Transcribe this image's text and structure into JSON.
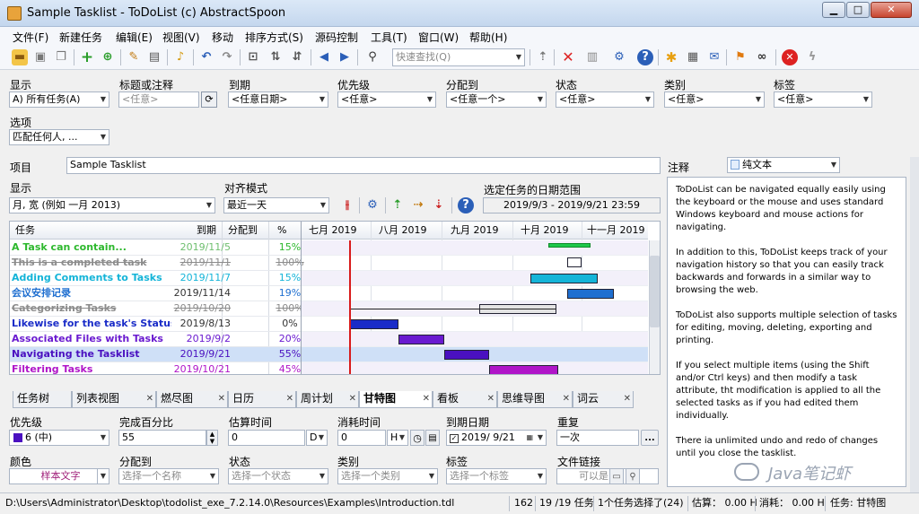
{
  "window": {
    "title": "Sample Tasklist - ToDoList (c) AbstractSpoon",
    "min": "▁",
    "max": "□",
    "close": "✕"
  },
  "menu": [
    "文件(F)",
    "新建任务",
    "编辑(E)",
    "视图(V)",
    "移动",
    "排序方式(S)",
    "源码控制",
    "工具(T)",
    "窗口(W)",
    "帮助(H)"
  ],
  "toolbar": {
    "quickfind_placeholder": "快速查找(Q)"
  },
  "filters": {
    "show_label": "显示",
    "show_value": "A)  所有任务(A)",
    "title_label": "标题或注释",
    "title_value": "<任意>",
    "due_label": "到期",
    "due_value": "<任意日期>",
    "priority_label": "优先级",
    "priority_value": "<任意>",
    "alloc_label": "分配到",
    "alloc_value": "<任意一个>",
    "status_label": "状态",
    "status_value": "<任意>",
    "category_label": "类别",
    "category_value": "<任意>",
    "tags_label": "标签",
    "tags_value": "<任意>",
    "options_label": "选项",
    "options_value": "匹配任何人, ..."
  },
  "project": {
    "label": "项目",
    "value": "Sample Tasklist"
  },
  "gantt_controls": {
    "show_label": "显示",
    "show_value": "月, 宽       (例如 一月 2013)",
    "snap_label": "对齐模式",
    "snap_value": "最近一天",
    "range_label": "选定任务的日期范围",
    "range_value": "2019/9/3 - 2019/9/21 23:59"
  },
  "columns": {
    "task": "任务",
    "due": "到期",
    "alloc": "分配到",
    "pct": "%"
  },
  "months": [
    "七月 2019",
    "八月 2019",
    "九月 2019",
    "十月 2019",
    "十一月 2019"
  ],
  "tasks": [
    {
      "name": "A Task can contain...",
      "due": "2019/11/5",
      "pct": "15%",
      "color": "#2db82d",
      "done": false
    },
    {
      "name": "This is a completed task",
      "due": "2019/11/1",
      "pct": "100%",
      "color": "#8c8c8c",
      "done": true
    },
    {
      "name": "Adding Comments to Tasks",
      "due": "2019/11/7",
      "pct": "15%",
      "color": "#14b4d8",
      "done": false
    },
    {
      "name": "会议安排记录",
      "due": "2019/11/14",
      "pct": "19%",
      "color": "#1f6fd0",
      "done": false
    },
    {
      "name": "Categorizing Tasks",
      "due": "2019/10/20",
      "pct": "100%",
      "color": "#8c8c8c",
      "done": true
    },
    {
      "name": "Likewise for the task's Status...",
      "due": "2019/8/13",
      "pct": "0%",
      "color": "#1a2cc8",
      "done": false
    },
    {
      "name": "Associated Files with Tasks",
      "due": "2019/9/2",
      "pct": "20%",
      "color": "#6a1ad0",
      "done": false
    },
    {
      "name": "Navigating the Tasklist",
      "due": "2019/9/21",
      "pct": "55%",
      "color": "#4a10c0",
      "done": false
    },
    {
      "name": "Filtering Tasks",
      "due": "2019/10/21",
      "pct": "45%",
      "color": "#b015c8",
      "done": false
    }
  ],
  "tabs": [
    "任务树",
    "列表视图",
    "燃尽图",
    "日历",
    "周计划",
    "甘特图",
    "看板",
    "思维导图",
    "词云"
  ],
  "notes": {
    "label": "注释",
    "format": "纯文本",
    "paragraphs": [
      "ToDoList can be navigated equally easily using the keyboard or the mouse and uses standard Windows keyboard and mouse actions for navigating.",
      "In addition to this, ToDoList keeps track of your navigation history so that you can easily track backwards and forwards in a similar way to browsing the web.",
      "ToDoList also supports multiple selection of tasks for editing, moving, deleting, exporting and printing.",
      "If you select multiple items (using the Shift and/or Ctrl keys) and then modify a task attribute, tht modification is applied to all the selected tasks as if you had edited them individually.",
      "There ia unlimited undo and redo of changes until you close the tasklist."
    ],
    "watermark": "Java笔记虾"
  },
  "attributes": {
    "priority_label": "优先级",
    "priority_value": "6 (中)",
    "priority_color": "#4a10c0",
    "pct_label": "完成百分比",
    "pct_value": "55",
    "est_label": "估算时间",
    "est_value": "0",
    "est_unit": "D",
    "spent_label": "消耗时间",
    "spent_value": "0",
    "spent_unit": "H",
    "due_label": "到期日期",
    "due_value": "2019/  9/21",
    "recur_label": "重复",
    "recur_value": "一次",
    "color_label": "颜色",
    "color_value": "样本文字",
    "alloc_label": "分配到",
    "alloc_value": "选择一个名称",
    "status_label": "状态",
    "status_value": "选择一个状态",
    "category_label": "类别",
    "category_value": "选择一个类别",
    "tags_label": "标签",
    "tags_value": "选择一个标签",
    "link_label": "文件链接",
    "link_value": "可以是"
  },
  "status": {
    "path": "D:\\Users\\Administrator\\Desktop\\todolist_exe_7.2.14.0\\Resources\\Examples\\Introduction.tdl",
    "id": "162",
    "count": "19 /19 任务",
    "selected": "1个任务选择了(24)",
    "est": "估算： 0.00 H",
    "spent": "消耗： 0.00 H",
    "view": "任务: 甘特图"
  }
}
